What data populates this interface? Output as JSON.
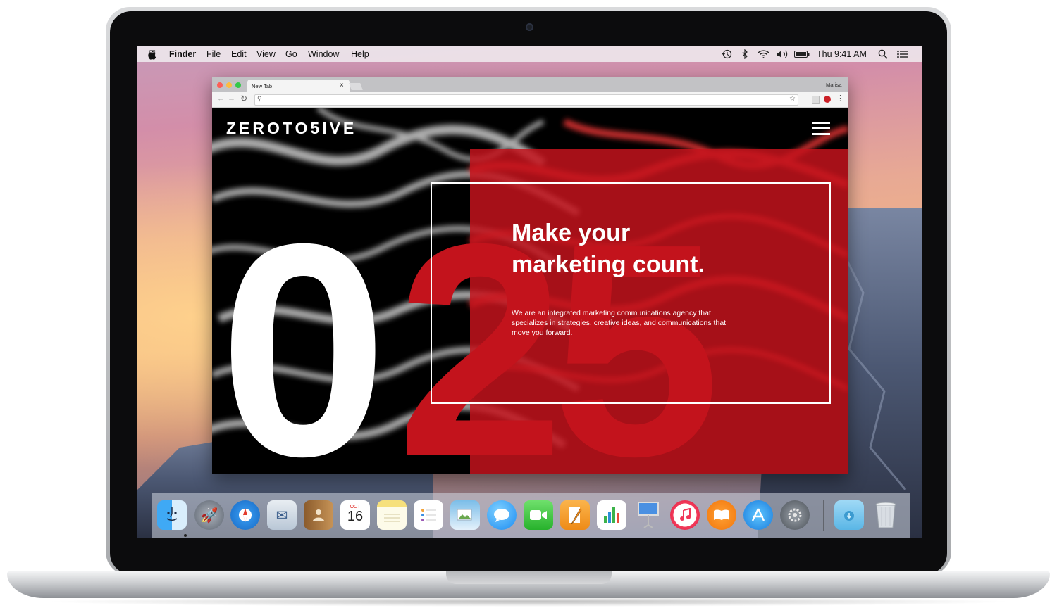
{
  "menubar": {
    "apple_icon": "apple-icon",
    "app_name": "Finder",
    "menus": [
      "File",
      "Edit",
      "View",
      "Go",
      "Window",
      "Help"
    ],
    "status_icons": [
      "time-machine-icon",
      "bluetooth-icon",
      "wifi-icon",
      "volume-icon",
      "battery-icon"
    ],
    "clock": "Thu 9:41 AM",
    "right_icons": [
      "spotlight-icon",
      "notification-center-icon"
    ]
  },
  "browser": {
    "tab_title": "New Tab",
    "tab_close": "×",
    "profile_name": "Marisa",
    "omnibox_value": "",
    "colors": {
      "close": "#fc5f57",
      "minimize": "#fdbc40",
      "zoom": "#34c84a"
    }
  },
  "website": {
    "logo": "ZEROTO5IVE",
    "hero_number_white": "0",
    "hero_number_red": "25",
    "headline_line1": "Make your",
    "headline_line2": "marketing count.",
    "subtext": "We are an integrated marketing communications agency that specializes in strategies, creative ideas, and communications that move you forward.",
    "accent_color": "#c3131c"
  },
  "dock": {
    "apps": [
      {
        "name": "Finder",
        "icon": "finder-icon"
      },
      {
        "name": "Launchpad",
        "icon": "launchpad-icon"
      },
      {
        "name": "Safari",
        "icon": "safari-icon"
      },
      {
        "name": "Mail",
        "icon": "mail-icon"
      },
      {
        "name": "Contacts",
        "icon": "contacts-icon"
      },
      {
        "name": "Calendar",
        "icon": "calendar-icon",
        "month": "OCT",
        "day": "16"
      },
      {
        "name": "Notes",
        "icon": "notes-icon"
      },
      {
        "name": "Reminders",
        "icon": "reminders-icon"
      },
      {
        "name": "Photo Booth",
        "icon": "photos-icon"
      },
      {
        "name": "Messages",
        "icon": "messages-icon"
      },
      {
        "name": "FaceTime",
        "icon": "facetime-icon"
      },
      {
        "name": "Pages",
        "icon": "pages-icon"
      },
      {
        "name": "Numbers",
        "icon": "numbers-icon"
      },
      {
        "name": "Keynote",
        "icon": "keynote-icon"
      },
      {
        "name": "iTunes",
        "icon": "itunes-icon"
      },
      {
        "name": "iBooks",
        "icon": "ibooks-icon"
      },
      {
        "name": "App Store",
        "icon": "app-store-icon"
      },
      {
        "name": "System Preferences",
        "icon": "system-preferences-icon"
      },
      {
        "name": "Downloads",
        "icon": "downloads-folder-icon"
      },
      {
        "name": "Trash",
        "icon": "trash-icon"
      }
    ]
  }
}
